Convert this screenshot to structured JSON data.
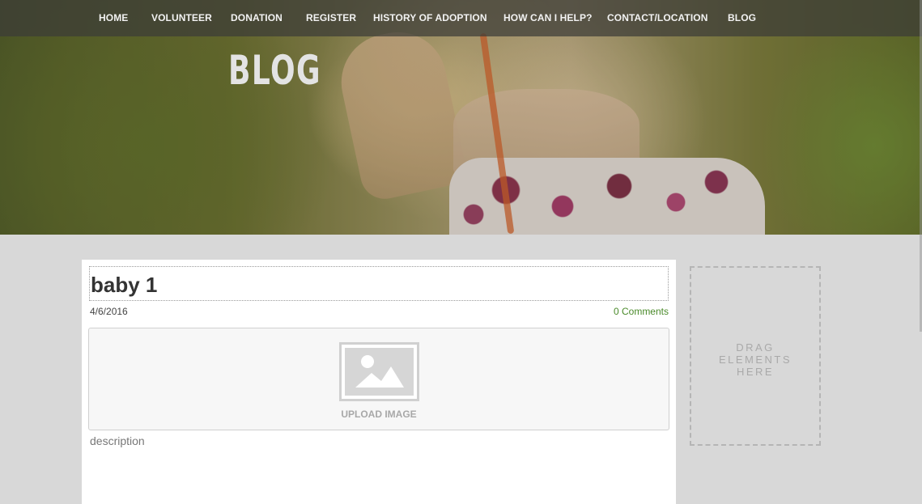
{
  "nav": {
    "items": [
      {
        "label": "HOME"
      },
      {
        "label": "VOLUNTEER"
      },
      {
        "label": "DONATION"
      },
      {
        "label": "REGISTER"
      },
      {
        "label": "HISTORY OF ADOPTION"
      },
      {
        "label": "HOW CAN I HELP?"
      },
      {
        "label": "CONTACT/LOCATION"
      },
      {
        "label": "BLOG"
      }
    ]
  },
  "hero": {
    "title": "BLOG"
  },
  "post": {
    "title": "baby 1",
    "date": "4/6/2016",
    "comments": "0 Comments",
    "upload_label": "UPLOAD IMAGE",
    "description": "description"
  },
  "sidebar": {
    "dropzone_text": "DRAG ELEMENTS HERE"
  },
  "colors": {
    "link_green": "#4a8a2a",
    "page_background": "#d8d8d8",
    "nav_text": "#f2f2f2"
  },
  "icons": {
    "upload_placeholder": "image-placeholder-icon"
  }
}
